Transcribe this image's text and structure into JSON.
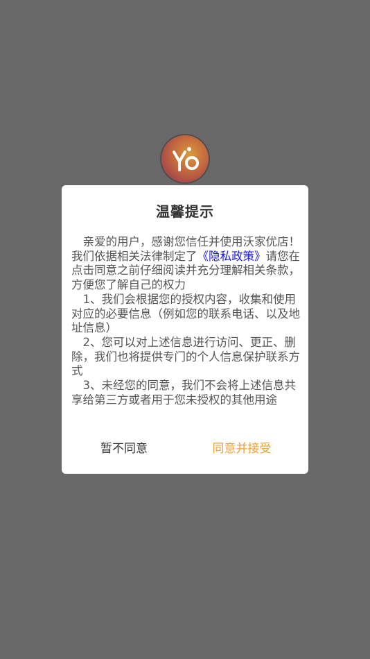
{
  "app": {
    "logo_icon": "yo-logo-icon"
  },
  "dialog": {
    "title": "温馨提示",
    "intro_before_link": "亲爱的用户，感谢您信任并使用沃家优店！我们依据相关法律制定了",
    "policy_link": "《隐私政策》",
    "intro_after_link": "请您在点击同意之前仔细阅读并充分理解相关条款，方便您了解自己的权力",
    "clauses": [
      "1、我们会根据您的授权内容，收集和使用对应的必要信息（例如您的联系电话、以及地址信息）",
      "2、您可以对上述信息进行访问、更正、删除，我们也将提供专门的个人信息保护联系方式",
      "3、未经您的同意，我们不会将上述信息共享给第三方或者用于您未授权的其他用途"
    ],
    "decline_label": "暂不同意",
    "accept_label": "同意并接受"
  },
  "colors": {
    "overlay": "#686868",
    "link": "#1a1adb",
    "accept": "#f0a030"
  }
}
